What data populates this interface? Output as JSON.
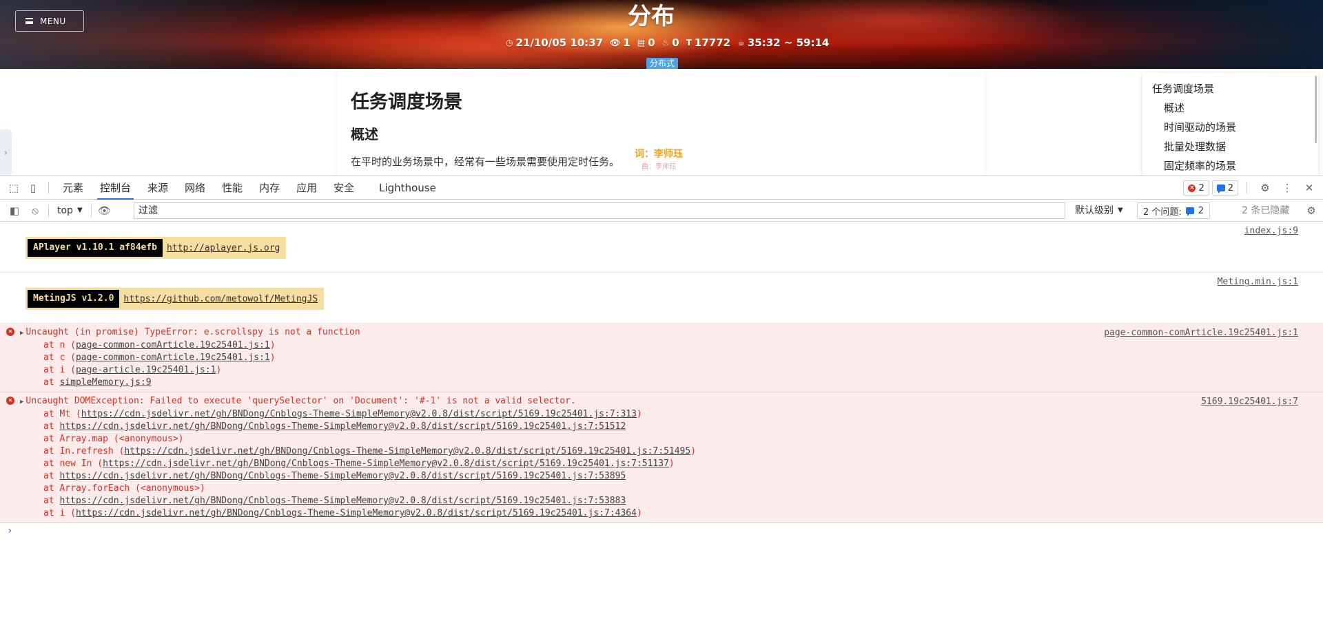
{
  "page": {
    "menu_label": "MENU",
    "title": "分布",
    "meta": {
      "date": "21/10/05 10:37",
      "views": "1",
      "comments": "0",
      "likes": "0",
      "words": "17772",
      "read_time": "35:32 ~ 59:14"
    },
    "tag": "分布式",
    "article": {
      "h1": "任务调度场景",
      "h2": "概述",
      "paragraph": "在平时的业务场景中，经常有一些场景需要使用定时任务。"
    },
    "lyric": {
      "line1": "词：李师珏",
      "line2": "曲：李师珏"
    },
    "toc": [
      "任务调度场景",
      "概述",
      "时间驱动的场景",
      "批量处理数据",
      "固定频率的场景"
    ]
  },
  "devtools": {
    "tabs": [
      "元素",
      "控制台",
      "来源",
      "网络",
      "性能",
      "内存",
      "应用",
      "安全",
      "Lighthouse"
    ],
    "active_tab": "控制台",
    "error_count": "2",
    "message_count": "2",
    "context": "top",
    "filter_placeholder": "过滤",
    "level": "默认级别",
    "issues_label": "2 个问题:",
    "issues_count": "2",
    "hidden_label": "2 条已隐藏"
  },
  "console": {
    "logs": [
      {
        "name": "APlayer v1.10.1 af84efb",
        "url": "http://aplayer.js.org",
        "source": "index.js:9"
      },
      {
        "name": "MetingJS v1.2.0",
        "url": "https://github.com/metowolf/MetingJS",
        "source": "Meting.min.js:1"
      }
    ],
    "errors": [
      {
        "message": "Uncaught (in promise) TypeError: e.scrollspy is not a function",
        "source": "page-common-comArticle.19c25401.js:1",
        "frames": [
          {
            "prefix": "at n (",
            "link": "page-common-comArticle.19c25401.js:1",
            "suffix": ")"
          },
          {
            "prefix": "at c (",
            "link": "page-common-comArticle.19c25401.js:1",
            "suffix": ")"
          },
          {
            "prefix": "at i (",
            "link": "page-article.19c25401.js:1",
            "suffix": ")"
          },
          {
            "prefix": "at ",
            "link": "simpleMemory.js:9",
            "suffix": ""
          }
        ]
      },
      {
        "message": "Uncaught DOMException: Failed to execute 'querySelector' on 'Document': '#-1' is not a valid selector.",
        "source": "5169.19c25401.js:7",
        "frames": [
          {
            "prefix": "at Mt (",
            "link": "https://cdn.jsdelivr.net/gh/BNDong/Cnblogs-Theme-SimpleMemory@v2.0.8/dist/script/5169.19c25401.js:7:313",
            "suffix": ")"
          },
          {
            "prefix": "at ",
            "link": "https://cdn.jsdelivr.net/gh/BNDong/Cnblogs-Theme-SimpleMemory@v2.0.8/dist/script/5169.19c25401.js:7:51512",
            "suffix": ""
          },
          {
            "prefix": "at Array.map (<anonymous>)",
            "link": "",
            "suffix": ""
          },
          {
            "prefix": "at In.refresh (",
            "link": "https://cdn.jsdelivr.net/gh/BNDong/Cnblogs-Theme-SimpleMemory@v2.0.8/dist/script/5169.19c25401.js:7:51495",
            "suffix": ")"
          },
          {
            "prefix": "at new In (",
            "link": "https://cdn.jsdelivr.net/gh/BNDong/Cnblogs-Theme-SimpleMemory@v2.0.8/dist/script/5169.19c25401.js:7:51137",
            "suffix": ")"
          },
          {
            "prefix": "at ",
            "link": "https://cdn.jsdelivr.net/gh/BNDong/Cnblogs-Theme-SimpleMemory@v2.0.8/dist/script/5169.19c25401.js:7:53895",
            "suffix": ""
          },
          {
            "prefix": "at Array.forEach (<anonymous>)",
            "link": "",
            "suffix": ""
          },
          {
            "prefix": "at ",
            "link": "https://cdn.jsdelivr.net/gh/BNDong/Cnblogs-Theme-SimpleMemory@v2.0.8/dist/script/5169.19c25401.js:7:53883",
            "suffix": ""
          },
          {
            "prefix": "at i (",
            "link": "https://cdn.jsdelivr.net/gh/BNDong/Cnblogs-Theme-SimpleMemory@v2.0.8/dist/script/5169.19c25401.js:7:4364",
            "suffix": ")"
          }
        ]
      }
    ]
  },
  "colors": {
    "accent": "#1a73e8",
    "error": "#d93025",
    "error_bg": "#fcebeb",
    "badge_bg": "#f6dda2"
  }
}
